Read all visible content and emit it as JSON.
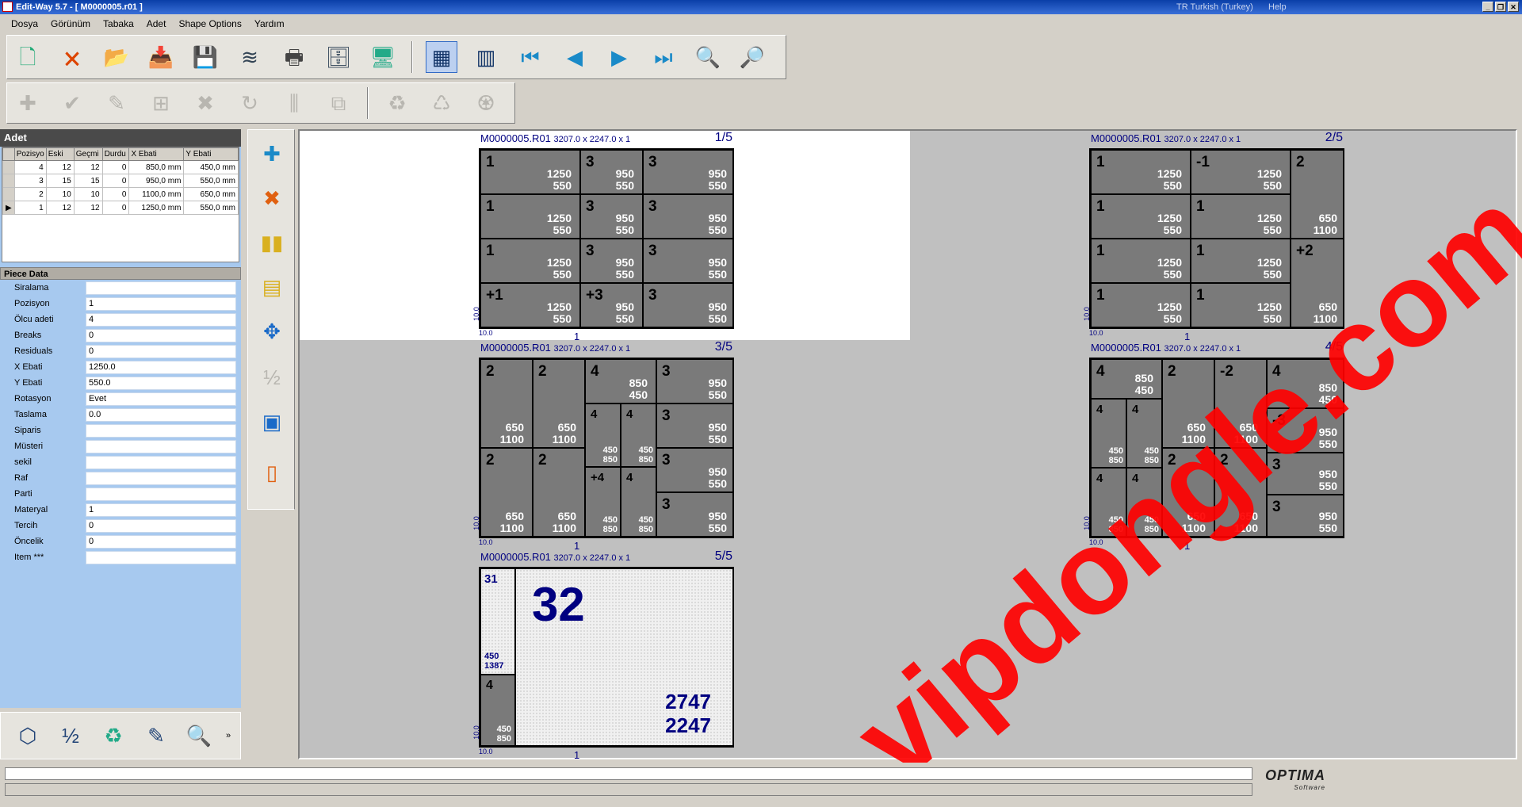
{
  "window": {
    "title": "Edit-Way 5.7  - [ M0000005.r01 ]",
    "lang": "TR Turkish (Turkey)",
    "help": "Help"
  },
  "menu": [
    "Dosya",
    "Görünüm",
    "Tabaka",
    "Adet",
    "Shape Options",
    "Yardım"
  ],
  "adet": {
    "title": "Adet",
    "columns": [
      "Pozisyo",
      "Eski",
      "Geçmi",
      "Durdu",
      "X Ebati",
      "Y Ebati"
    ],
    "rows": [
      [
        "4",
        "12",
        "12",
        "0",
        "850,0 mm",
        "450,0 mm"
      ],
      [
        "3",
        "15",
        "15",
        "0",
        "950,0 mm",
        "550,0 mm"
      ],
      [
        "2",
        "10",
        "10",
        "0",
        "1100,0 mm",
        "650,0 mm"
      ],
      [
        "1",
        "12",
        "12",
        "0",
        "1250,0 mm",
        "550,0 mm"
      ]
    ]
  },
  "piece_data": {
    "title": "Piece Data",
    "fields": [
      {
        "label": "Siralama",
        "value": ""
      },
      {
        "label": "Pozisyon",
        "value": "1"
      },
      {
        "label": "Ölcu adeti",
        "value": "4"
      },
      {
        "label": "Breaks",
        "value": "0"
      },
      {
        "label": "Residuals",
        "value": "0"
      },
      {
        "label": "X Ebati",
        "value": "1250.0"
      },
      {
        "label": "Y Ebati",
        "value": "550.0"
      },
      {
        "label": "Rotasyon",
        "value": "Evet"
      },
      {
        "label": "Taslama",
        "value": "0.0"
      },
      {
        "label": "Siparis",
        "value": ""
      },
      {
        "label": "Müsteri",
        "value": ""
      },
      {
        "label": "sekil",
        "value": ""
      },
      {
        "label": "Raf",
        "value": ""
      },
      {
        "label": "Parti",
        "value": ""
      },
      {
        "label": "Materyal",
        "value": "1"
      },
      {
        "label": "Tercih",
        "value": "0"
      },
      {
        "label": "Öncelik",
        "value": "0"
      },
      {
        "label": "Item ***",
        "value": ""
      }
    ]
  },
  "sheets": [
    {
      "name": "M0000005.R01",
      "dims": "3207.0 x  2247.0 x 1",
      "page": "1/5",
      "trim": "10.0",
      "count": "1",
      "pieces": [
        [
          "1",
          "1250",
          "550"
        ],
        [
          "3",
          "950",
          "550"
        ],
        [
          "3",
          "950",
          "550"
        ],
        [
          "1",
          "1250",
          "550"
        ],
        [
          "3",
          "950",
          "550"
        ],
        [
          "3",
          "950",
          "550"
        ],
        [
          "1",
          "1250",
          "550"
        ],
        [
          "3",
          "950",
          "550"
        ],
        [
          "3",
          "950",
          "550"
        ],
        [
          "+1",
          "1250",
          "550"
        ],
        [
          "+3",
          "950",
          "550"
        ],
        [
          "3",
          "950",
          "550"
        ]
      ]
    },
    {
      "name": "M0000005.R01",
      "dims": "3207.0 x  2247.0 x 1",
      "page": "2/5",
      "trim": "10.0",
      "count": "1",
      "pieces": [
        [
          "1",
          "1250",
          "550"
        ],
        [
          "-1",
          "1250",
          "550"
        ],
        [
          "2",
          "650",
          "1100"
        ],
        [
          "1",
          "1250",
          "550"
        ],
        [
          "1",
          "1250",
          "550"
        ],
        [
          "1",
          "1250",
          "550"
        ],
        [
          "1",
          "1250",
          "550"
        ],
        [
          "+2",
          "650",
          "1100"
        ],
        [
          "1",
          "1250",
          "550"
        ],
        [
          "1",
          "1250",
          "550"
        ]
      ]
    },
    {
      "name": "M0000005.R01",
      "dims": "3207.0 x  2247.0 x 1",
      "page": "3/5",
      "trim": "10.0",
      "count": "1",
      "pieces": [
        [
          "2",
          "650",
          "1100"
        ],
        [
          "2",
          "650",
          "1100"
        ],
        [
          "4",
          "850",
          "450"
        ],
        [
          "3",
          "950",
          "550"
        ],
        [
          "4",
          "450",
          "850"
        ],
        [
          "4",
          "450",
          "850"
        ],
        [
          "3",
          "950",
          "550"
        ],
        [
          "2",
          "650",
          "1100"
        ],
        [
          "2",
          "650",
          "1100"
        ],
        [
          "3",
          "950",
          "550"
        ],
        [
          "+4",
          "450",
          "850"
        ],
        [
          "4",
          "450",
          "850"
        ],
        [
          "3",
          "950",
          "550"
        ]
      ]
    },
    {
      "name": "M0000005.R01",
      "dims": "3207.0 x  2247.0 x 1",
      "page": "4/5",
      "trim": "10.0",
      "count": "1",
      "pieces": [
        [
          "4",
          "850",
          "450"
        ],
        [
          "2",
          "650",
          "1100"
        ],
        [
          "-2",
          "650",
          "1100"
        ],
        [
          "4",
          "850",
          "450"
        ],
        [
          "4",
          "450",
          "850"
        ],
        [
          "4",
          "450",
          "850"
        ],
        [
          "-3",
          "950",
          "550"
        ],
        [
          "4",
          "450",
          "850"
        ],
        [
          "4",
          "450",
          "850"
        ],
        [
          "2",
          "650",
          "1100"
        ],
        [
          "2",
          "650",
          "1100"
        ],
        [
          "3",
          "950",
          "550"
        ],
        [
          "3",
          "950",
          "550"
        ]
      ]
    },
    {
      "name": "M0000005.R01",
      "dims": "3207.0 x  2247.0 x 1",
      "page": "5/5",
      "trim": "10.0",
      "count": "1",
      "p31": "31",
      "p31dims": "450\n1387",
      "p4": "4",
      "p4dims": "450\n850",
      "big": "32",
      "waste": "2747\n2247"
    }
  ],
  "watermark": "vipdongle.com",
  "brand": {
    "name": "OPTIMA",
    "sub": "Software"
  }
}
